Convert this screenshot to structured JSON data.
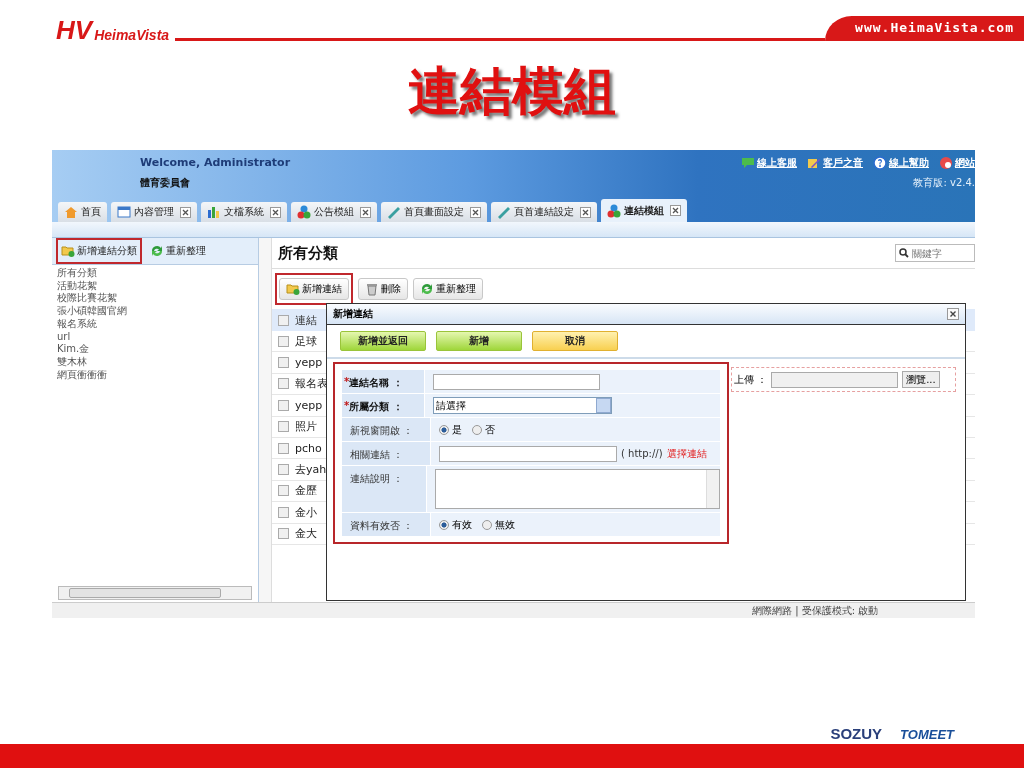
{
  "slide": {
    "brand_mark": "HV",
    "brand": "HeimaVista",
    "url": "www.HeimaVista.com",
    "title": "連結模組",
    "footer_logos": [
      "SOZUY",
      "TOMEET"
    ]
  },
  "app": {
    "welcome": "Welcome, Administrator",
    "org": "體育委員會",
    "links": [
      {
        "label": "線上客服"
      },
      {
        "label": "客戶之音"
      },
      {
        "label": "線上幫助"
      },
      {
        "label": "網站"
      }
    ],
    "version": "教育版: v2.4.",
    "tabs": [
      {
        "label": "首頁",
        "closable": false,
        "selected": false
      },
      {
        "label": "內容管理",
        "closable": true,
        "selected": false
      },
      {
        "label": "文檔系統",
        "closable": true,
        "selected": false
      },
      {
        "label": "公告模組",
        "closable": true,
        "selected": false
      },
      {
        "label": "首頁畫面設定",
        "closable": true,
        "selected": false
      },
      {
        "label": "頁首連結設定",
        "closable": true,
        "selected": false
      },
      {
        "label": "連結模組",
        "closable": true,
        "selected": true
      }
    ]
  },
  "sidebar": {
    "buttons": [
      {
        "label": "新增連結分類",
        "highlighted": true
      },
      {
        "label": "重新整理",
        "highlighted": false
      }
    ],
    "items": [
      "所有分類",
      "活動花絮",
      "校際比賽花絮",
      "張小碩韓國官網",
      "報名系統",
      "url",
      "Kim.金",
      "雙木林",
      "網頁衝衝衝"
    ]
  },
  "main": {
    "heading": "所有分類",
    "search": {
      "placeholder": "關鍵字"
    },
    "toolbar": [
      {
        "label": "新增連結",
        "highlighted": true
      },
      {
        "label": "刪除",
        "highlighted": false
      },
      {
        "label": "重新整理",
        "highlighted": false
      }
    ],
    "table": {
      "column": "連結",
      "all_checked": false,
      "rows": [
        {
          "name": "足球",
          "checked": false
        },
        {
          "name": "yepp",
          "checked": false
        },
        {
          "name": "報名表",
          "checked": false
        },
        {
          "name": "yepp",
          "checked": false
        },
        {
          "name": "照片",
          "checked": false
        },
        {
          "name": "pcho",
          "checked": false
        },
        {
          "name": "去yah",
          "checked": false
        },
        {
          "name": "金歷",
          "checked": false
        },
        {
          "name": "金小",
          "checked": false
        },
        {
          "name": "金大",
          "checked": false
        }
      ]
    }
  },
  "dialog": {
    "title": "新增連結",
    "buttons": [
      {
        "label": "新增並返回",
        "kind": "primary"
      },
      {
        "label": "新增",
        "kind": "primary"
      },
      {
        "label": "取消",
        "kind": "cancel"
      }
    ],
    "highlighted": true,
    "fields": [
      {
        "kind": "text",
        "mark": "*",
        "label": "連結名稱 ：",
        "required": true
      },
      {
        "kind": "select",
        "mark": "*",
        "label": "所屬分類 ：",
        "required": true,
        "value": "請選擇"
      },
      {
        "kind": "radio",
        "label": "新視窗開啟 ：",
        "required": false,
        "options": [
          {
            "label": "是",
            "selected": true
          },
          {
            "label": "否",
            "selected": false
          }
        ]
      },
      {
        "kind": "url",
        "label": "相關連結 ：",
        "required": false,
        "hint": "( http://)",
        "link": "選擇連結"
      },
      {
        "kind": "textarea",
        "label": "連結說明 ：",
        "required": false
      },
      {
        "kind": "radio",
        "label": "資料有效否 ：",
        "required": false,
        "options": [
          {
            "label": "有效",
            "selected": true
          },
          {
            "label": "無效",
            "selected": false
          }
        ]
      }
    ],
    "upload": {
      "label": "上傳 ：",
      "button": "瀏覽..."
    }
  },
  "status_bar": "網際網路 | 受保護模式: 啟動"
}
